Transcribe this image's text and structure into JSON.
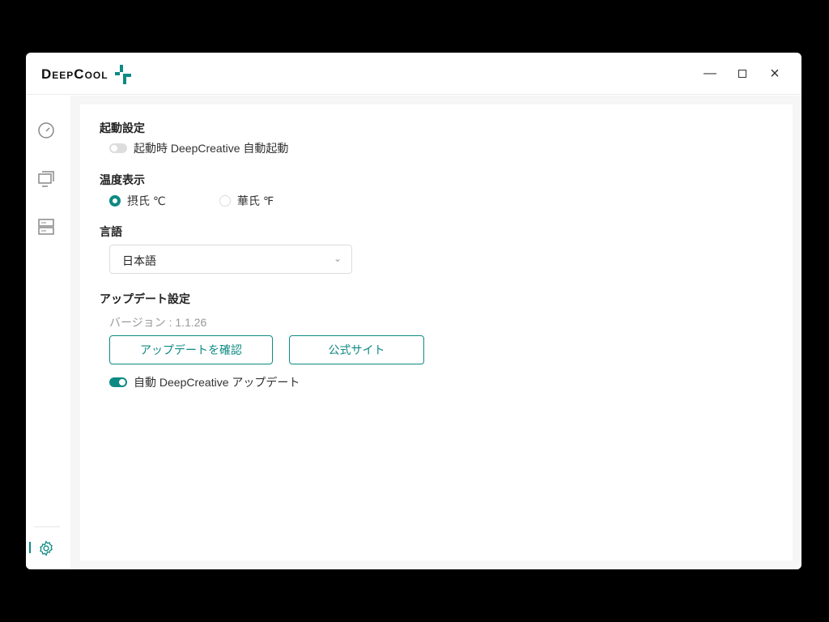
{
  "app": {
    "logo_text": "DeepCool",
    "minimize_icon": "minimize-icon",
    "maximize_icon": "maximize-icon",
    "close_icon": "close-icon"
  },
  "sidebar": {
    "items": [
      {
        "icon": "gauge-icon"
      },
      {
        "icon": "monitor-icon"
      },
      {
        "icon": "storage-icon"
      },
      {
        "icon": "gear-icon",
        "active": true
      }
    ]
  },
  "startup": {
    "title": "起動設定",
    "autostart_label": "起動時 DeepCreative 自動起動",
    "autostart_on": false
  },
  "temperature": {
    "title": "温度表示",
    "options": [
      {
        "label": "摂氏 ℃",
        "selected": true
      },
      {
        "label": "華氏 ℉",
        "selected": false
      }
    ]
  },
  "language": {
    "title": "言語",
    "selected": "日本語"
  },
  "update": {
    "title": "アップデート設定",
    "version": "バージョン : 1.1.26",
    "check_button": "アップデートを確認",
    "site_button": "公式サイト",
    "auto_update_label": "自動 DeepCreative アップデート",
    "auto_update_on": true
  },
  "colors": {
    "accent": "#0e8a84"
  }
}
